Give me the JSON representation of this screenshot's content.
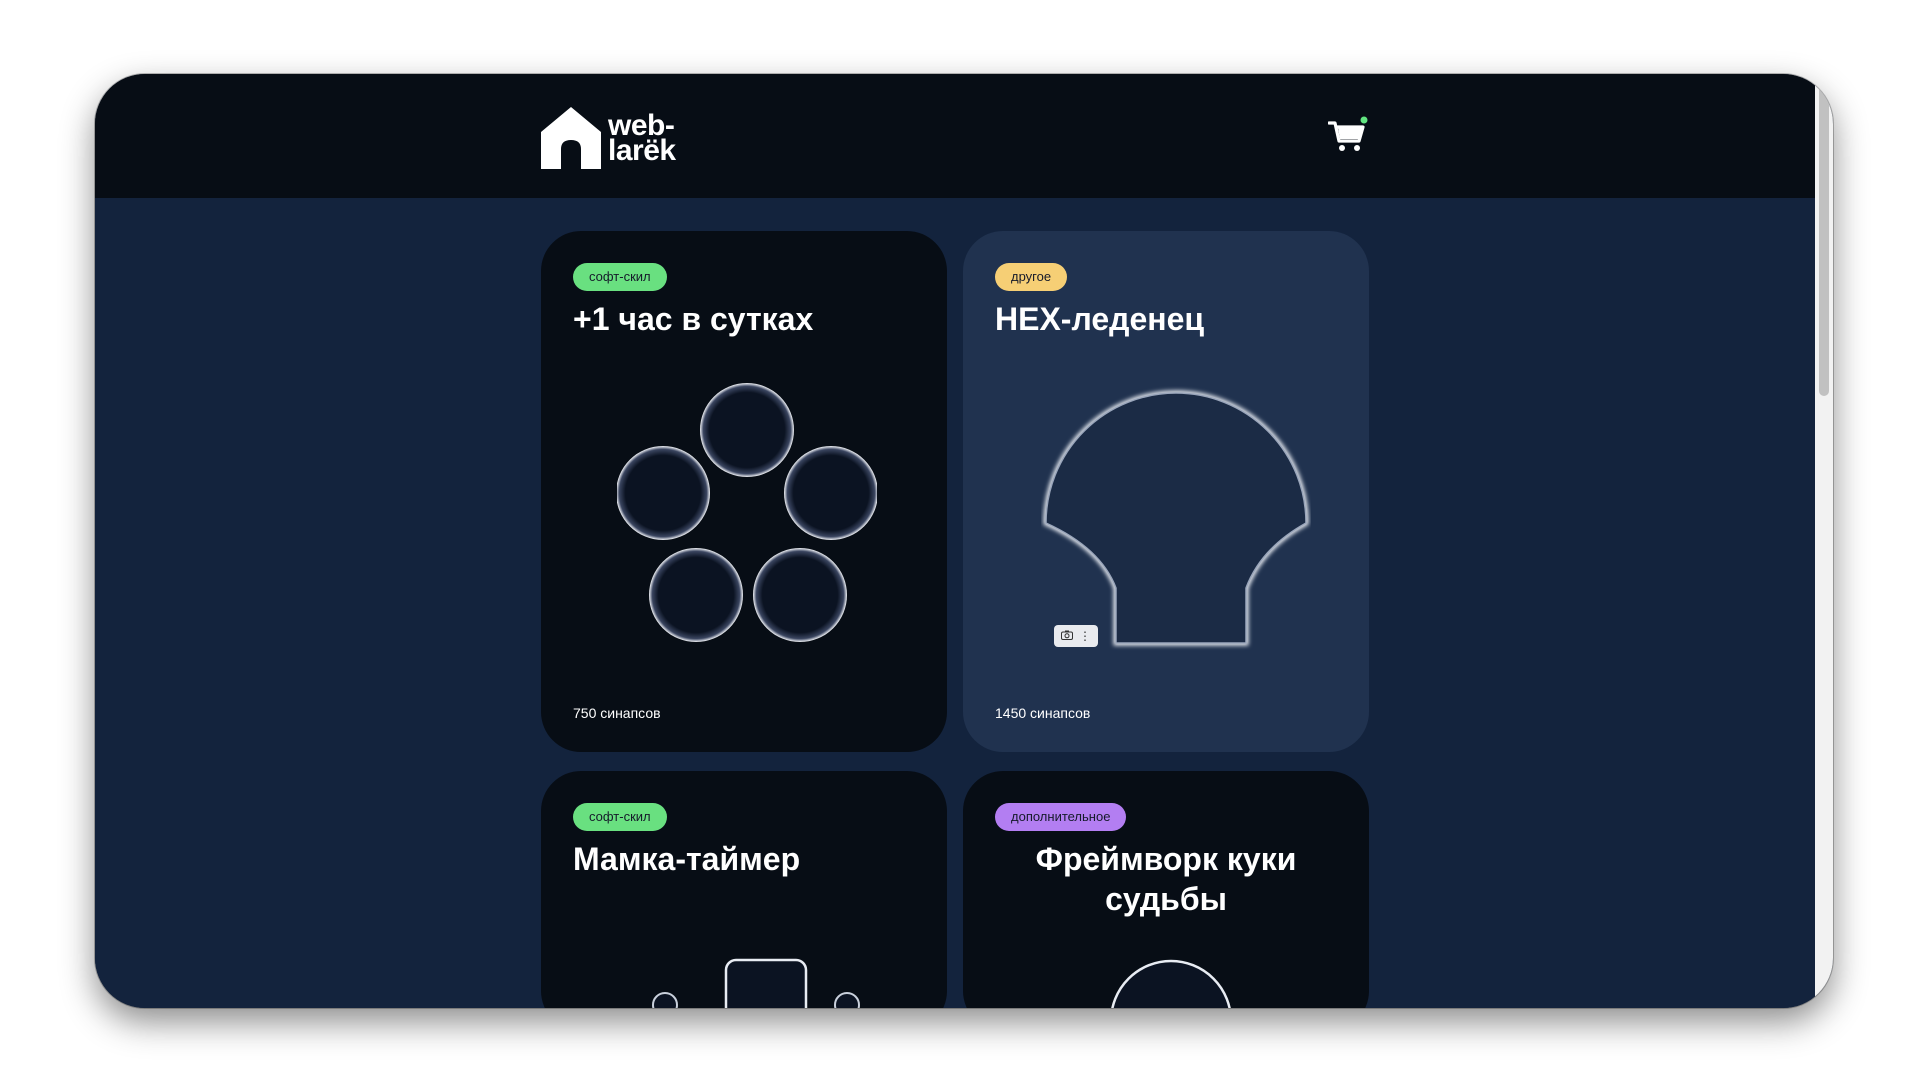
{
  "header": {
    "logo_line1": "web-",
    "logo_line2": "larёk",
    "logo_icon": "house-icon",
    "cart_icon": "shopping-cart-icon",
    "cart_badge_color": "#61e480"
  },
  "colors": {
    "page_background": "#13233d",
    "header_background": "#070d15",
    "card_dark": "#070d15",
    "card_light": "#20324f",
    "badge_soft_skill": "#69e080",
    "badge_other": "#f6cf75",
    "badge_additional": "#b37ef2"
  },
  "products": [
    {
      "category": "софт-скил",
      "title": "+1 час в сутках",
      "price": "750 синапсов"
    },
    {
      "category": "другое",
      "title": "HEX-леденец",
      "price": "1450 синапсов"
    },
    {
      "category": "софт-скил",
      "title": "Мамка-таймер"
    },
    {
      "category": "дополнительное",
      "title": "Фреймворк куки судьбы"
    }
  ],
  "image_tools": {
    "camera_icon": "camera-icon",
    "more_icon": "more-vertical-icon"
  }
}
